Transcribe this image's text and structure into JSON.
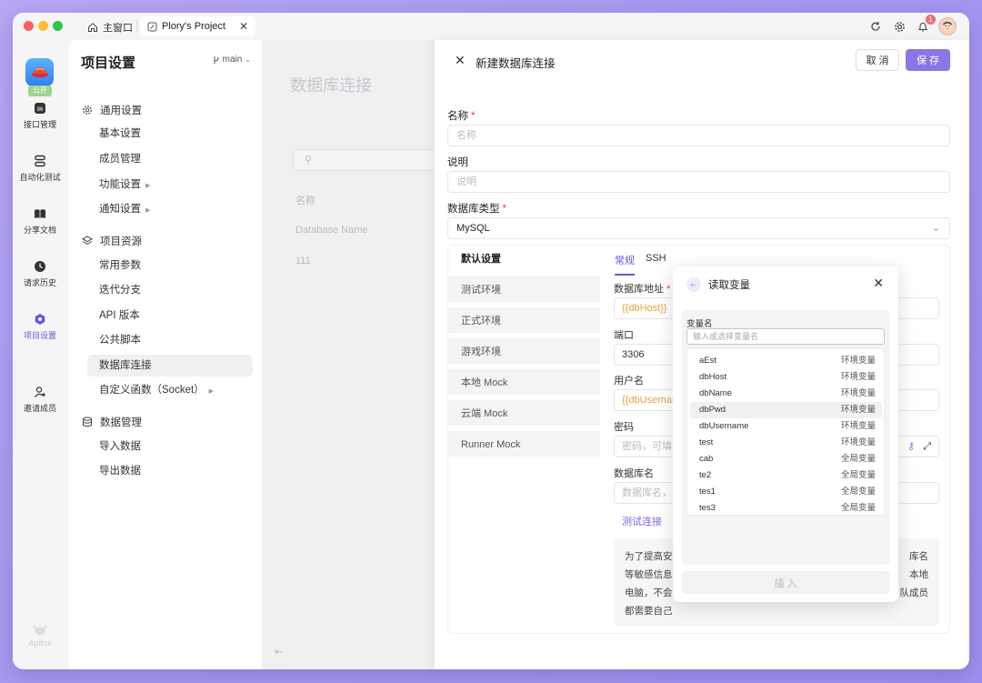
{
  "titlebar": {
    "home_tab": "主窗口",
    "project_tab": "Plory's Project",
    "notification_count": "1"
  },
  "rail": {
    "public_badge": "公开",
    "items": [
      {
        "label": "接口管理",
        "icon": "api-icon"
      },
      {
        "label": "自动化测试",
        "icon": "automation-icon"
      },
      {
        "label": "分享文档",
        "icon": "book-icon"
      },
      {
        "label": "请求历史",
        "icon": "clock-icon"
      },
      {
        "label": "项目设置",
        "icon": "settings-hex-icon"
      },
      {
        "label": "邀请成员",
        "icon": "add-user-icon"
      }
    ],
    "footer": "Apifox"
  },
  "sidebar": {
    "title": "项目设置",
    "branch": "main",
    "sections": [
      {
        "label": "通用设置",
        "items": [
          "基本设置",
          "成员管理",
          "功能设置",
          "通知设置"
        ]
      },
      {
        "label": "项目资源",
        "items": [
          "常用参数",
          "迭代分支",
          "API 版本",
          "公共脚本",
          "数据库连接",
          "自定义函数（Socket）"
        ]
      },
      {
        "label": "数据管理",
        "items": [
          "导入数据",
          "导出数据"
        ]
      }
    ]
  },
  "middle": {
    "title": "数据库连接",
    "col_name": "名称",
    "row_db_name": "Database Name",
    "row_value": "111"
  },
  "drawer": {
    "title": "新建数据库连接",
    "cancel": "取 消",
    "save": "保 存",
    "name_label": "名称",
    "name_placeholder": "名称",
    "desc_label": "说明",
    "desc_placeholder": "说明",
    "dbtype_label": "数据库类型",
    "dbtype_value": "MySQL",
    "envs": [
      "默认设置",
      "测试环境",
      "正式环境",
      "游戏环境",
      "本地 Mock",
      "云端 Mock",
      "Runner Mock"
    ],
    "tabs": [
      "常规",
      "SSH"
    ],
    "host_label": "数据库地址",
    "host_value": "{{dbHost}}",
    "port_label": "端口",
    "port_value": "3306",
    "user_label": "用户名",
    "user_value": "{{dbUsername}}",
    "pwd_label": "密码",
    "pwd_placeholder": "密码，可填入",
    "dbname_label": "数据库名",
    "dbname_placeholder": "数据库名，可",
    "test_link": "测试连接",
    "note_lines": [
      "为了提高安",
      "等敏感信息",
      "电脑，不会",
      "都需要自己"
    ],
    "note_right": [
      "库名",
      "本地",
      "队成员"
    ]
  },
  "popup": {
    "title": "读取变量",
    "var_label": "变量名",
    "input_placeholder": "输入或选择变量名",
    "rows": [
      {
        "name": "aEst",
        "scope": "环境变量"
      },
      {
        "name": "dbHost",
        "scope": "环境变量"
      },
      {
        "name": "dbName",
        "scope": "环境变量"
      },
      {
        "name": "dbPwd",
        "scope": "环境变量"
      },
      {
        "name": "dbUsername",
        "scope": "环境变量"
      },
      {
        "name": "test",
        "scope": "环境变量"
      },
      {
        "name": "cab",
        "scope": "全局变量"
      },
      {
        "name": "te2",
        "scope": "全局变量"
      },
      {
        "name": "tes1",
        "scope": "全局变量"
      },
      {
        "name": "tes3",
        "scope": "全局变量"
      }
    ],
    "insert": "插 入"
  }
}
